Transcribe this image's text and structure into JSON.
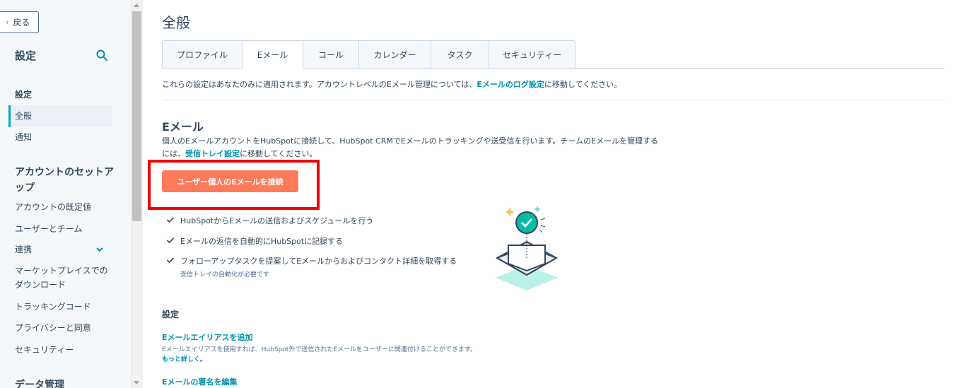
{
  "sidebar": {
    "back_label": "戻る",
    "title": "設定",
    "section_settings": "設定",
    "items_settings": [
      "全般",
      "通知"
    ],
    "section_account": "アカウントのセットアップ",
    "items_account": [
      "アカウントの既定値",
      "ユーザーとチーム",
      "連携",
      "マーケットプレイスでのダウンロード",
      "トラッキングコード",
      "プライバシーと同意",
      "セキュリティー"
    ],
    "section_data": "データ管理"
  },
  "main": {
    "page_title": "全般",
    "tabs": [
      "プロファイル",
      "Eメール",
      "コール",
      "カレンダー",
      "タスク",
      "セキュリティー"
    ],
    "active_tab": "Eメール",
    "notice_prefix": "これらの設定はあなたのみに適用されます。アカウントレベルのEメール管理については、",
    "notice_link": "Eメールのログ設定",
    "notice_suffix": "に移動してください。",
    "section_title": "Eメール",
    "section_desc_line1": "個人のEメールアカウントをHubSpotに接続して、HubSpot CRMでEメールのトラッキングや送受信を行います。チームのEメールを管理する",
    "section_desc_prefix2": "には、",
    "section_desc_link": "受信トレイ設定",
    "section_desc_suffix2": "に移動してください。",
    "connect_button": "ユーザー個人のEメールを接続",
    "features": [
      "HubSpotからEメールの送信およびスケジュールを行う",
      "Eメールの返信を自動的にHubSpotに記録する",
      "フォローアップタスクを提案してEメールからおよびコンタクト詳細を取得する"
    ],
    "feature_note": "受信トレイの自動化が必要です",
    "settings_title": "設定",
    "alias_link": "Eメールエイリアスを追加",
    "alias_desc": "Eメールエイリアスを使用すれば、HubSpot外で送信されたEメールをユーザーに関連付けることができます。",
    "more_link": "もっと詳しく。",
    "signature_link": "Eメールの署名を編集"
  },
  "colors": {
    "accent": "#00a4bd",
    "link": "#0091ae",
    "cta": "#ff7a59",
    "highlight": "#f00000"
  }
}
